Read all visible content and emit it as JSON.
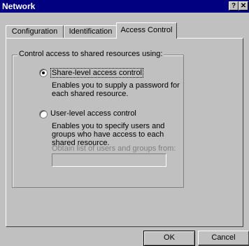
{
  "window": {
    "title": "Network"
  },
  "titlebar": {
    "help_glyph": "?",
    "close_glyph": "✕"
  },
  "tabs": [
    {
      "label": "Configuration"
    },
    {
      "label": "Identification"
    },
    {
      "label": "Access Control",
      "active": true
    }
  ],
  "access": {
    "group_label": "Control access to shared resources using:",
    "share": {
      "label": "Share-level access control",
      "description": "Enables you to supply a password for each shared resource.",
      "selected": true
    },
    "user": {
      "label": "User-level access control",
      "description": "Enables you to specify users and groups who have access to each shared resource.",
      "selected": false
    },
    "obtain_label": "Obtain list of users and groups from:",
    "obtain_value": ""
  },
  "buttons": {
    "ok": "OK",
    "cancel": "Cancel"
  }
}
